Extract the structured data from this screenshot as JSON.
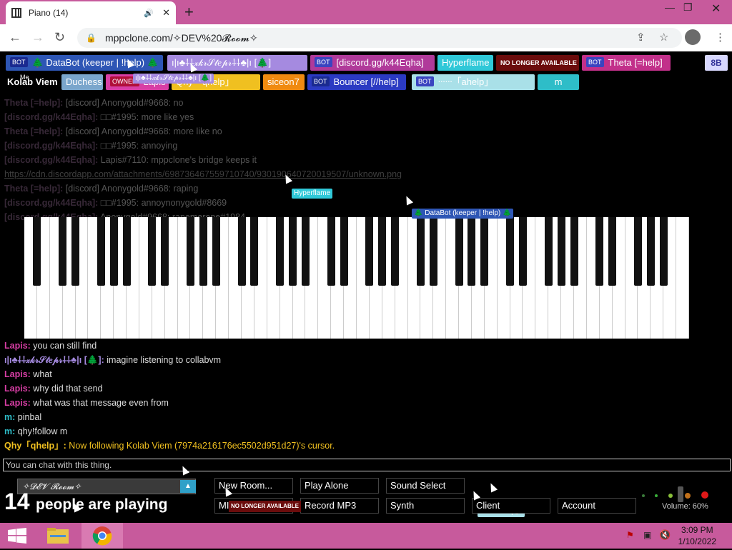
{
  "browser": {
    "tab_title": "Piano (14)",
    "tab_close": "✕",
    "new_tab": "+",
    "url": "mppclone.com/✧DEV%20𝓡𝓸𝓸𝓶✧"
  },
  "top_users_row1": [
    {
      "bot": true,
      "label": "🌲 DataBot (keeper | !help) 🌲",
      "bg": "#2e56b5",
      "fg": "#ffffff"
    },
    {
      "bot": false,
      "label": "ı|ı♣⸸⸸𝓍𝓀𝓇𝒮𝓉𝑒𝓅𝓇⸸⸸♣|ı [🌲]",
      "bg": "#a58ae0",
      "fg": "#ffffff"
    },
    {
      "bot": true,
      "label": "[discord.gg/k44Eqha]",
      "bg": "#b03a9a",
      "fg": "#ffffff"
    },
    {
      "bot": false,
      "label": "Hyperflame",
      "bg": "#2fc8d8",
      "fg": "#ffffff"
    },
    {
      "bot": false,
      "label": "NO LONGER AVAILABLE",
      "bg": "#6b0c0c",
      "fg": "#ffffff"
    },
    {
      "bot": true,
      "label": "Theta [=help]",
      "bg": "#c2308a",
      "fg": "#ffffff"
    },
    {
      "bot": false,
      "label": "8B",
      "bg": "#d8d8ff",
      "fg": "#333399"
    }
  ],
  "top_users_row2": [
    {
      "bot": false,
      "label": "Kolab Viem",
      "bg": "#000000",
      "fg": "#ffffff",
      "owner": false
    },
    {
      "bot": false,
      "label": "Duchess",
      "bg": "#7aa6cc",
      "fg": "#ffffff",
      "owner": false
    },
    {
      "bot": false,
      "label": "Lapis",
      "bg": "#d83ea5",
      "fg": "#ffffff",
      "owner": true
    },
    {
      "bot": false,
      "label": "Qhy「qhelp」",
      "bg": "#f0c020",
      "fg": "#ffffff",
      "owner": false
    },
    {
      "bot": false,
      "label": "siceon7",
      "bg": "#f08a10",
      "fg": "#ffffff",
      "owner": false
    },
    {
      "bot": true,
      "label": "Bouncer [//help]",
      "bg": "#2b3ac2",
      "fg": "#ffffff",
      "owner": false
    },
    {
      "bot": true,
      "label": "ᐧᐧᐧᐧᐧᐧ「ahelp」",
      "bg": "#a9e0e8",
      "fg": "#ffffff",
      "owner": false
    },
    {
      "bot": false,
      "label": "m",
      "bg": "#2ebdc8",
      "fg": "#ffffff",
      "owner": false
    }
  ],
  "labels": {
    "bot": "BOT",
    "owner": "OWNER",
    "me": "Me"
  },
  "chat": [
    {
      "nick": "Theta [=help]:",
      "nick_color": "#7a5a7a",
      "text": "[discord] Anonygold#9668: no",
      "dim": true
    },
    {
      "nick": "[discord.gg/k44Eqha]:",
      "nick_color": "#7a5a7a",
      "text": "□□#1995: more like yes",
      "dim": true
    },
    {
      "nick": "Theta [=help]:",
      "nick_color": "#7a5a7a",
      "text": "[discord] Anonygold#9668: more like no",
      "dim": true
    },
    {
      "nick": "[discord.gg/k44Eqha]:",
      "nick_color": "#7a5a7a",
      "text": "□□#1995: annoying",
      "dim": true
    },
    {
      "nick": "[discord.gg/k44Eqha]:",
      "nick_color": "#7a5a7a",
      "text": "Lapis#7110: mppclone's bridge keeps it",
      "dim": true
    },
    {
      "nick": "",
      "nick_color": "#7a5a7a",
      "text": "https://cdn.discordapp.com/attachments/698736467559710740/930190640720019507/unknown.png",
      "dim": true
    },
    {
      "nick": "Theta [=help]:",
      "nick_color": "#7a5a7a",
      "text": "[discord] Anonygold#9668: raping",
      "dim": true
    },
    {
      "nick": "[discord.gg/k44Eqha]:",
      "nick_color": "#7a5a7a",
      "text": "□□#1995: annoynonygold#8669",
      "dim": true
    },
    {
      "nick": "[discord.gg/k44Eqha]:",
      "nick_color": "#7a5a7a",
      "text": "Anonygold#9668: rapemerope#1984",
      "dim": true
    },
    {
      "nick": "Lapis:",
      "nick_color": "#d83ea5",
      "text": "you can still find",
      "dim": false
    },
    {
      "nick": "ı|ı♣⸸⸸𝓍𝓀𝓇𝒮𝓉𝑒𝓅𝓇⸸⸸♣|ı [🌲]:",
      "nick_color": "#a58ae0",
      "text": "imagine listening to collabvm",
      "dim": false
    },
    {
      "nick": "Lapis:",
      "nick_color": "#d83ea5",
      "text": "what",
      "dim": false
    },
    {
      "nick": "Lapis:",
      "nick_color": "#d83ea5",
      "text": "why did that send",
      "dim": false
    },
    {
      "nick": "Lapis:",
      "nick_color": "#d83ea5",
      "text": "what was that message even from",
      "dim": false
    },
    {
      "nick": "m:",
      "nick_color": "#2ebdc8",
      "text": "pinbal",
      "dim": false
    },
    {
      "nick": "m:",
      "nick_color": "#2ebdc8",
      "text": "qhy!follow m",
      "dim": false
    },
    {
      "nick": "Qhy「qhelp」:",
      "nick_color": "#f0c020",
      "text": "Now following Kolab Viem (7974a216176ec5502d951d27)'s cursor.",
      "dim": false
    }
  ],
  "chat_placeholder": "You can chat with this thing.",
  "cursor_tags": [
    {
      "label": "Hyperflame",
      "bg": "#2fc8d8"
    },
    {
      "label": "🌲 DataBot (keeper | !help) 🌲",
      "bg": "#2e56b5"
    },
    {
      "label": "ı|ı♣⸸⸸𝓍𝓀𝓇𝒮𝓉𝑒𝓅𝓇⸸⸸♣|ı [🌲]",
      "bg": "#a58ae0"
    },
    {
      "label": "Theta [=help]",
      "bg": "#c2308a"
    },
    {
      "label": "ᐧᐧᐧᐧᐧᐧ「ahelp」",
      "bg": "#a9e0e8"
    }
  ],
  "room": {
    "name": "✧𝓓𝓔𝓥 𝓡𝓸𝓸𝓶✧",
    "count": "14",
    "count_text": "people are playing"
  },
  "buttons": {
    "new_room": "New Room...",
    "play_alone": "Play Alone",
    "sound_select": "Sound Select",
    "midi": "MIDI",
    "record_mp3": "Record MP3",
    "synth": "Synth",
    "client": "Client",
    "account": "Account"
  },
  "volume_text": "Volume: 60%",
  "clock": {
    "time": "3:09 PM",
    "date": "1/10/2022"
  }
}
